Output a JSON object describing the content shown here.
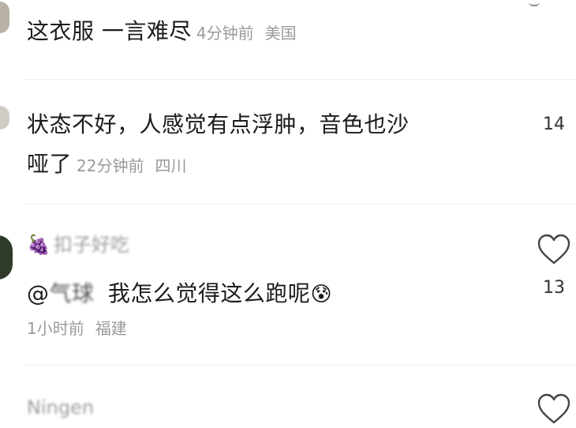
{
  "comments": [
    {
      "text": "这衣服 一言难尽",
      "time": "4分钟前",
      "location": "美国"
    },
    {
      "text_line1": "状态不好，人感觉有点浮肿，音色也沙",
      "text_line2": "哑了",
      "time": "22分钟前",
      "location": "四川",
      "likes": "14"
    },
    {
      "user": "扣子好吃",
      "user_emoji": "🍇",
      "mention": "@气球",
      "text": "我怎么觉得这么跑呢",
      "emoji": "😰",
      "time": "1小时前",
      "location": "福建",
      "likes": "13"
    },
    {
      "user": "Ningen"
    }
  ],
  "icons": {
    "like": "heart-outline-icon"
  }
}
